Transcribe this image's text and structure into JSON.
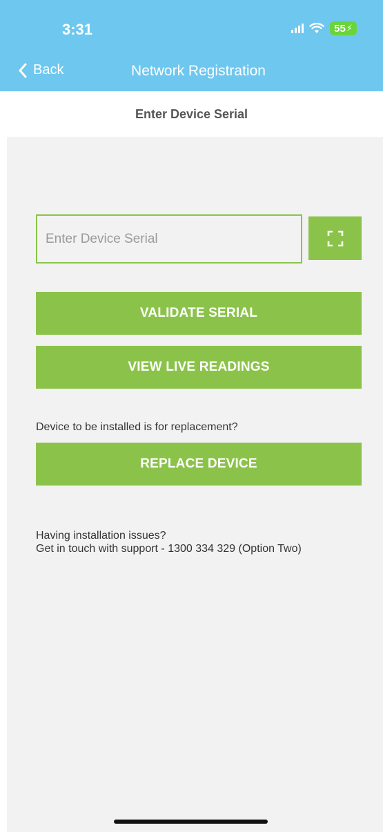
{
  "status_bar": {
    "time": "3:31",
    "battery": "55",
    "icons": [
      "cellular-signal-icon",
      "wifi-icon",
      "battery-charging-icon"
    ]
  },
  "nav": {
    "back_label": "Back",
    "title": "Network Registration"
  },
  "subheader": {
    "title": "Enter Device Serial"
  },
  "form": {
    "serial_value": "",
    "serial_placeholder": "Enter Device Serial",
    "scan_icon": "scan-frame-icon"
  },
  "buttons": {
    "validate": "VALIDATE SERIAL",
    "live": "VIEW LIVE READINGS",
    "replace": "REPLACE DEVICE"
  },
  "replace_prompt": "Device to be installed is for replacement?",
  "support": {
    "line1": "Having installation issues?",
    "line2": "Get in touch with support - 1300 334 329 (Option Two)"
  },
  "colors": {
    "header": "#6ec7ee",
    "accent": "#8bc34a",
    "background": "#f2f2f2",
    "battery": "#6ad43c"
  }
}
